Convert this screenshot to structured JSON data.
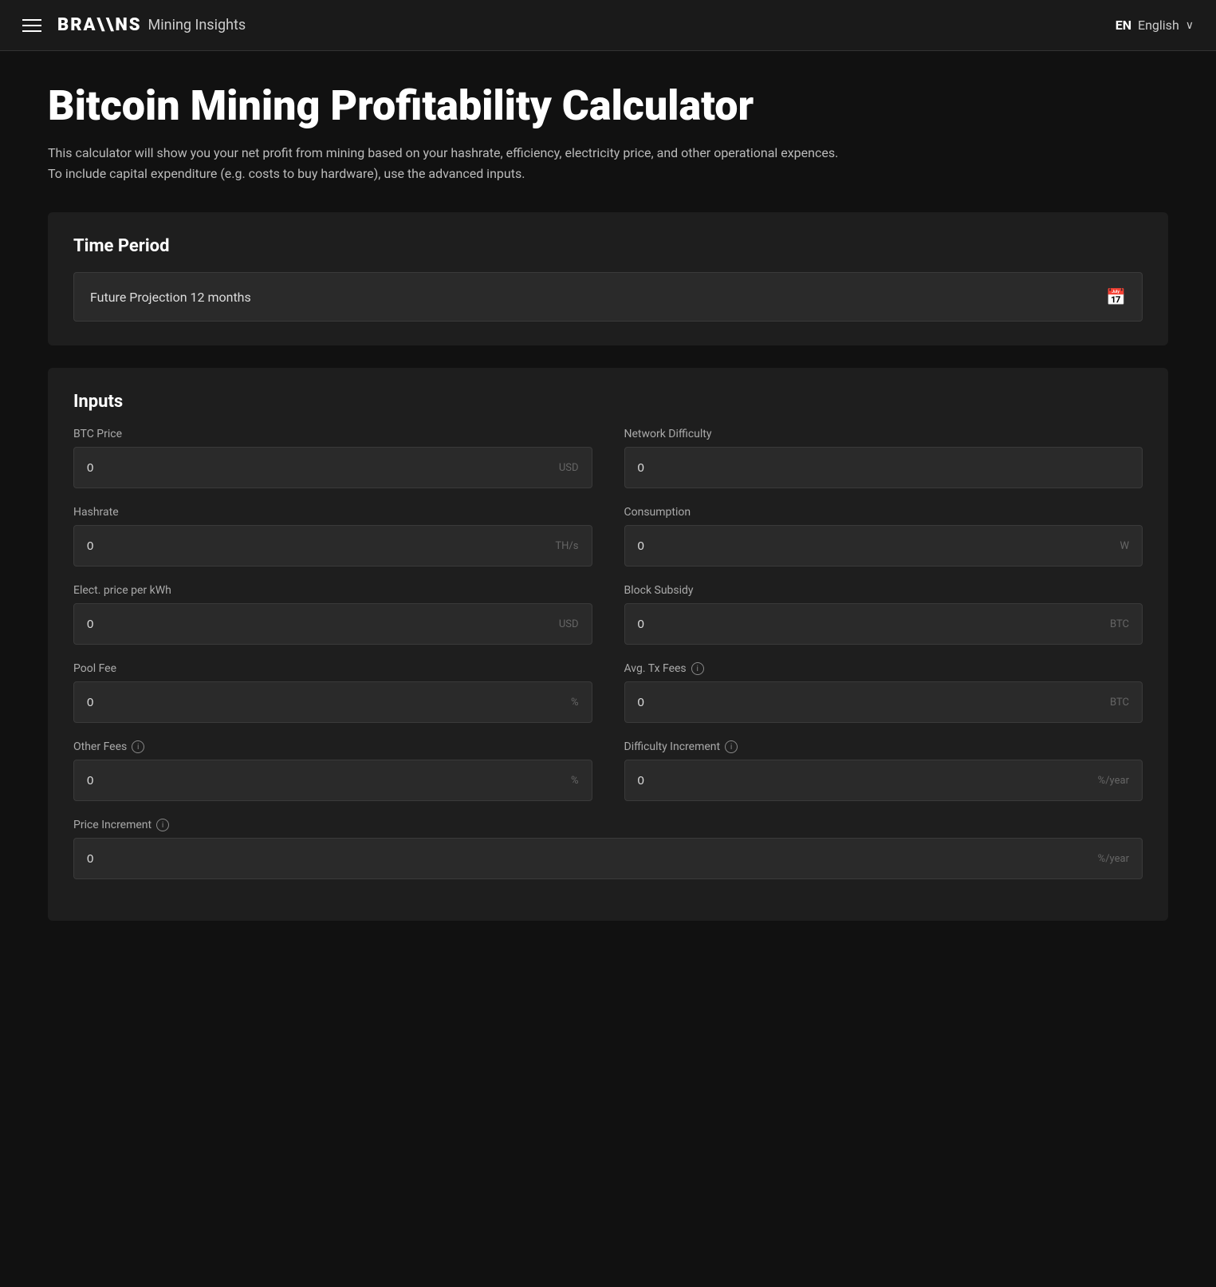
{
  "navbar": {
    "brand_logo": "BRA\\\\NS",
    "brand_title": "Mining Insights",
    "lang_code": "EN",
    "lang_label": "English",
    "chevron": "∨"
  },
  "page": {
    "title": "Bitcoin Mining Profitability Calculator",
    "description": "This calculator will show you your net profit from mining based on your hashrate, efficiency, electricity price, and other operational expences. To include capital expenditure (e.g. costs to buy hardware), use the advanced inputs."
  },
  "time_period": {
    "section_title": "Time Period",
    "selected_value": "Future Projection 12 months"
  },
  "inputs": {
    "section_title": "Inputs",
    "fields": [
      {
        "id": "btc-price",
        "label": "BTC Price",
        "value": "0",
        "unit": "USD",
        "has_info": false
      },
      {
        "id": "network-difficulty",
        "label": "Network Difficulty",
        "value": "0",
        "unit": "",
        "has_info": false
      },
      {
        "id": "hashrate",
        "label": "Hashrate",
        "value": "0",
        "unit": "TH/s",
        "has_info": false
      },
      {
        "id": "consumption",
        "label": "Consumption",
        "value": "0",
        "unit": "W",
        "has_info": false
      },
      {
        "id": "elect-price",
        "label": "Elect. price per kWh",
        "value": "0",
        "unit": "USD",
        "has_info": false
      },
      {
        "id": "block-subsidy",
        "label": "Block Subsidy",
        "value": "0",
        "unit": "BTC",
        "has_info": false
      },
      {
        "id": "pool-fee",
        "label": "Pool Fee",
        "value": "0",
        "unit": "%",
        "has_info": false
      },
      {
        "id": "avg-tx-fees",
        "label": "Avg. Tx Fees",
        "value": "0",
        "unit": "BTC",
        "has_info": true
      },
      {
        "id": "other-fees",
        "label": "Other Fees",
        "value": "0",
        "unit": "%",
        "has_info": true
      },
      {
        "id": "difficulty-increment",
        "label": "Difficulty Increment",
        "value": "0",
        "unit": "%/year",
        "has_info": true
      }
    ],
    "full_width_fields": [
      {
        "id": "price-increment",
        "label": "Price Increment",
        "value": "0",
        "unit": "%/year",
        "has_info": true
      }
    ]
  }
}
